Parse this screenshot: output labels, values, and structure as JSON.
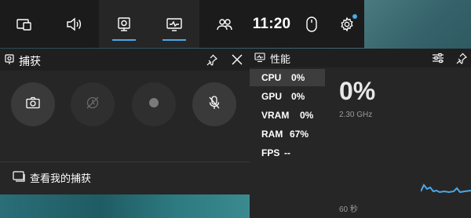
{
  "topbar": {
    "clock": "11:20",
    "buttons": [
      {
        "name": "widget-menu",
        "icon": "widget-menu-icon"
      },
      {
        "name": "audio",
        "icon": "speaker-icon"
      },
      {
        "name": "capture",
        "icon": "capture-icon",
        "active": true
      },
      {
        "name": "performance",
        "icon": "performance-icon",
        "active": true
      },
      {
        "name": "xbox-social",
        "icon": "people-icon"
      },
      {
        "name": "mouse",
        "icon": "mouse-icon"
      },
      {
        "name": "settings",
        "icon": "gear-icon"
      }
    ],
    "accent": "#4aa8e8"
  },
  "capture": {
    "title": "捕获",
    "buttons": [
      {
        "name": "screenshot",
        "icon": "camera-icon",
        "enabled": true
      },
      {
        "name": "record-last",
        "icon": "record-last-icon",
        "enabled": false
      },
      {
        "name": "start-recording",
        "icon": "record-dot-icon",
        "enabled": false
      },
      {
        "name": "mic",
        "icon": "mic-off-icon",
        "enabled": true
      }
    ],
    "show_all_link": "查看我的捕获"
  },
  "performance": {
    "title": "性能",
    "metrics": [
      {
        "name": "CPU",
        "value": "0%",
        "selected": true
      },
      {
        "name": "GPU",
        "value": "0%"
      },
      {
        "name": "VRAM",
        "value": "0%"
      },
      {
        "name": "RAM",
        "value": "67%"
      },
      {
        "name": "FPS",
        "value": "--"
      }
    ],
    "big_value": "0%",
    "frequency": "2.30 GHz",
    "time_window": "60 秒"
  }
}
